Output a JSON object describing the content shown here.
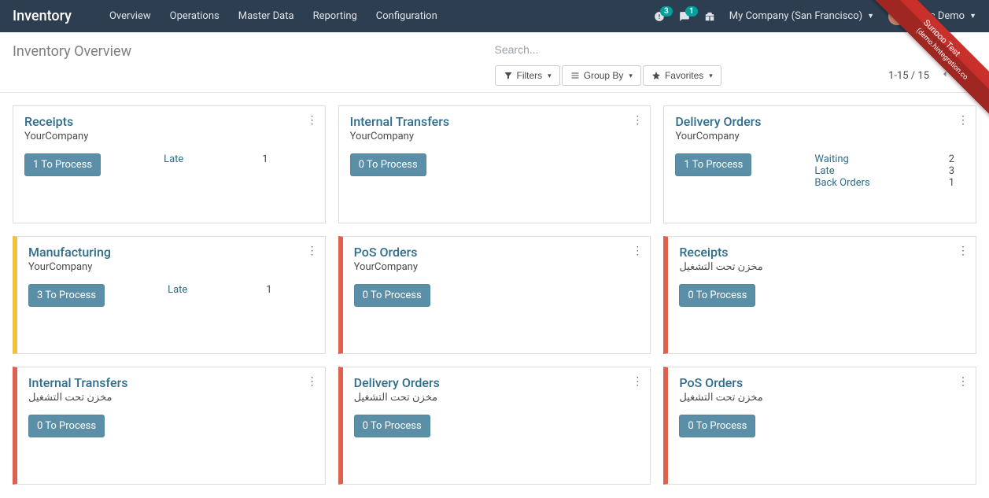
{
  "nav": {
    "brand": "Inventory",
    "items": [
      "Overview",
      "Operations",
      "Master Data",
      "Reporting",
      "Configuration"
    ],
    "activity_badge": "3",
    "messaging_badge": "1",
    "company": "My Company (San Francisco)",
    "user": "Marc Demo"
  },
  "ribbon": {
    "line1": "Sunpop Test",
    "line2": "(demo.hintegration.co"
  },
  "breadcrumb": "Inventory Overview",
  "search": {
    "placeholder": "Search...",
    "filters_label": "Filters",
    "groupby_label": "Group By",
    "favorites_label": "Favorites",
    "pager_text": "1-15 / 15"
  },
  "cards": [
    {
      "title": "Receipts",
      "subtitle": "YourCompany",
      "button": "1 To Process",
      "bar": "",
      "stats": [
        {
          "label": "Late",
          "value": "1"
        }
      ]
    },
    {
      "title": "Internal Transfers",
      "subtitle": "YourCompany",
      "button": "0 To Process",
      "bar": "",
      "stats": []
    },
    {
      "title": "Delivery Orders",
      "subtitle": "YourCompany",
      "button": "1 To Process",
      "bar": "",
      "stats": [
        {
          "label": "Waiting",
          "value": "2"
        },
        {
          "label": "Late",
          "value": "3"
        },
        {
          "label": "Back Orders",
          "value": "1"
        }
      ]
    },
    {
      "title": "Manufacturing",
      "subtitle": "YourCompany",
      "button": "3 To Process",
      "bar": "yellow",
      "stats": [
        {
          "label": "Late",
          "value": "1"
        }
      ]
    },
    {
      "title": "PoS Orders",
      "subtitle": "YourCompany",
      "button": "0 To Process",
      "bar": "red",
      "stats": []
    },
    {
      "title": "Receipts",
      "subtitle": "مخزن تحت التشغيل",
      "button": "0 To Process",
      "bar": "red",
      "stats": []
    },
    {
      "title": "Internal Transfers",
      "subtitle": "مخزن تحت التشغيل",
      "button": "0 To Process",
      "bar": "red",
      "stats": []
    },
    {
      "title": "Delivery Orders",
      "subtitle": "مخزن تحت التشغيل",
      "button": "0 To Process",
      "bar": "red",
      "stats": []
    },
    {
      "title": "PoS Orders",
      "subtitle": "مخزن تحت التشغيل",
      "button": "0 To Process",
      "bar": "red",
      "stats": []
    }
  ]
}
